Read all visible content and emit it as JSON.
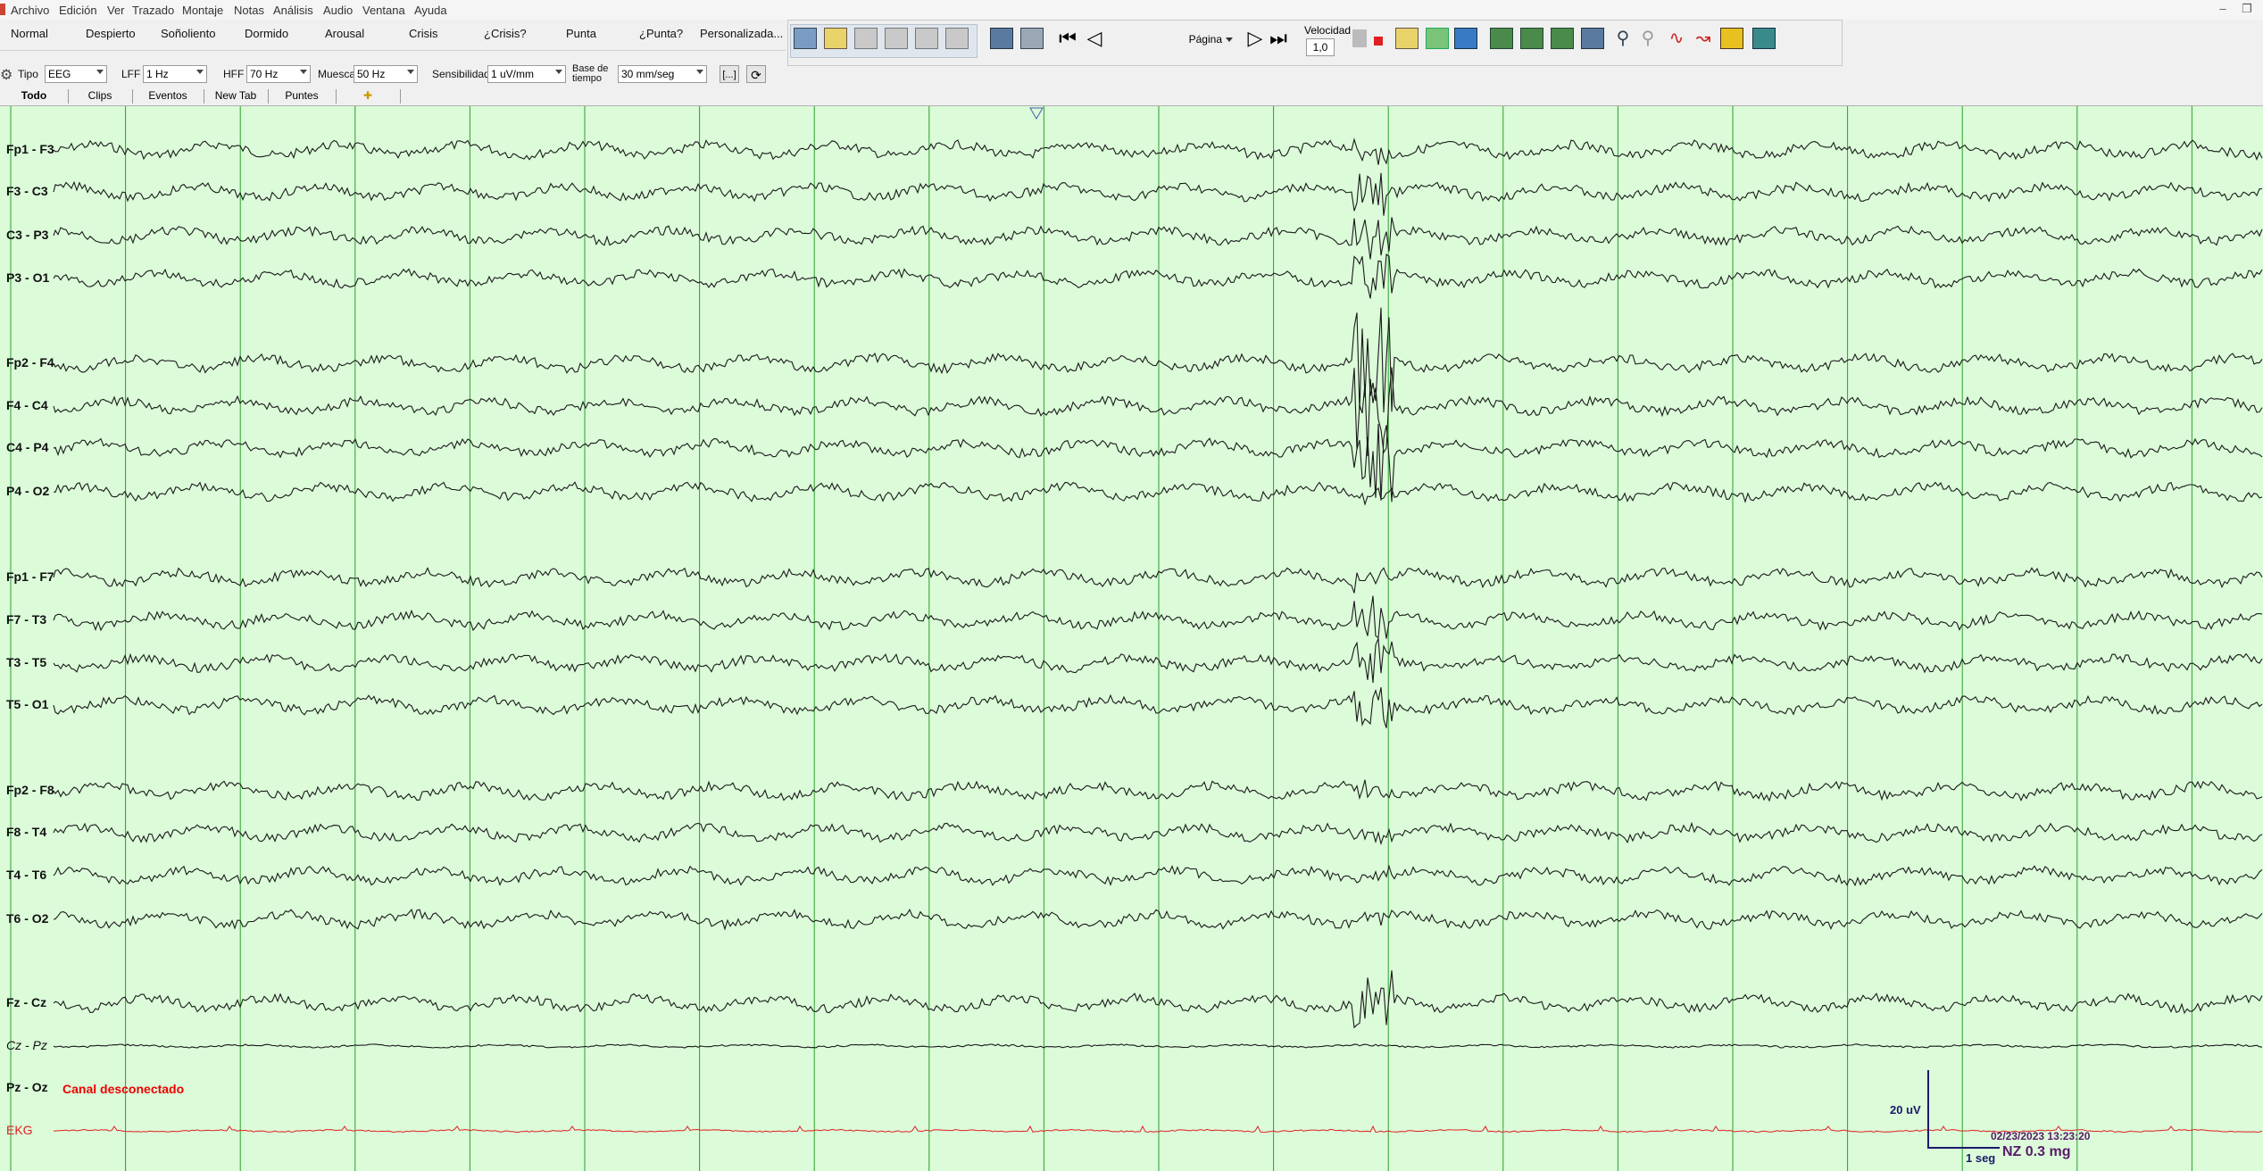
{
  "menu": [
    "Archivo",
    "Edición",
    "Ver",
    "Trazado",
    "Montaje",
    "Notas",
    "Análisis",
    "Audio",
    "Ventana",
    "Ayuda"
  ],
  "states": [
    "Normal",
    "Despierto",
    "Soñoliento",
    "Dormido",
    "Arousal",
    "Crisis",
    "¿Crisis?",
    "Punta",
    "¿Punta?",
    "Personalizada..."
  ],
  "toolbar": {
    "page_select": "Página",
    "speed_label": "Velocidad",
    "speed_value": "1,0",
    "icons": [
      "montage-1-icon",
      "montage-2-icon",
      "montage-3-icon",
      "montage-4-icon",
      "montage-5-icon",
      "montage-6-icon",
      "video-icon",
      "camera-icon",
      "rewind-icon",
      "step-back-icon",
      "play-icon",
      "fast-forward-icon",
      "marker-icon",
      "event-icon",
      "spike-icon",
      "channels-icon",
      "search-user-icon",
      "report-icon",
      "review-icon",
      "export-icon",
      "zoom-in-icon",
      "zoom-out-icon",
      "waveform-icon",
      "arrow-icon",
      "highlight-icon",
      "settings-icon"
    ]
  },
  "filters": {
    "tipo_label": "Tipo",
    "tipo_value": "EEG",
    "lff_label": "LFF",
    "lff_value": "1 Hz",
    "hff_label": "HFF",
    "hff_value": "70 Hz",
    "muesca_label": "Muesca",
    "muesca_value": "50 Hz",
    "sens_label": "Sensibilidad",
    "sens_value": "1 uV/mm",
    "base_label": "Base de tiempo",
    "base_value": "30 mm/seg",
    "bracket_label": "[...]"
  },
  "tabs": [
    "Todo",
    "Clips",
    "Eventos",
    "New Tab",
    "Puntes"
  ],
  "channels": [
    {
      "name": "Fp1 - F3"
    },
    {
      "name": "F3 - C3"
    },
    {
      "name": "C3 - P3"
    },
    {
      "name": "P3 - O1"
    },
    {
      "name": "Fp2 - F4"
    },
    {
      "name": "F4 - C4"
    },
    {
      "name": "C4 - P4"
    },
    {
      "name": "P4 - O2"
    },
    {
      "name": "Fp1 - F7"
    },
    {
      "name": "F7 - T3"
    },
    {
      "name": "T3 - T5"
    },
    {
      "name": "T5 - O1"
    },
    {
      "name": "Fp2 - F8"
    },
    {
      "name": "F8 - T4"
    },
    {
      "name": "T4 - T6"
    },
    {
      "name": "T6 - O2"
    },
    {
      "name": "Fz - Cz"
    },
    {
      "name": "Cz - Pz"
    },
    {
      "name": "Pz - Oz"
    },
    {
      "name": "EKG"
    }
  ],
  "disconnected_text": "Canal desconectado",
  "scale": {
    "amplitude": "20 uV",
    "time": "1 seg"
  },
  "timestamp": "02/23/2023 13:23:20",
  "annotation": "NZ 0.3 mg",
  "colors": {
    "background": "#dbfbd9",
    "grid": "#2e9e2e",
    "trace": "#1a1a1a",
    "ekg": "#e02020",
    "scale": "#1a1a6a"
  }
}
